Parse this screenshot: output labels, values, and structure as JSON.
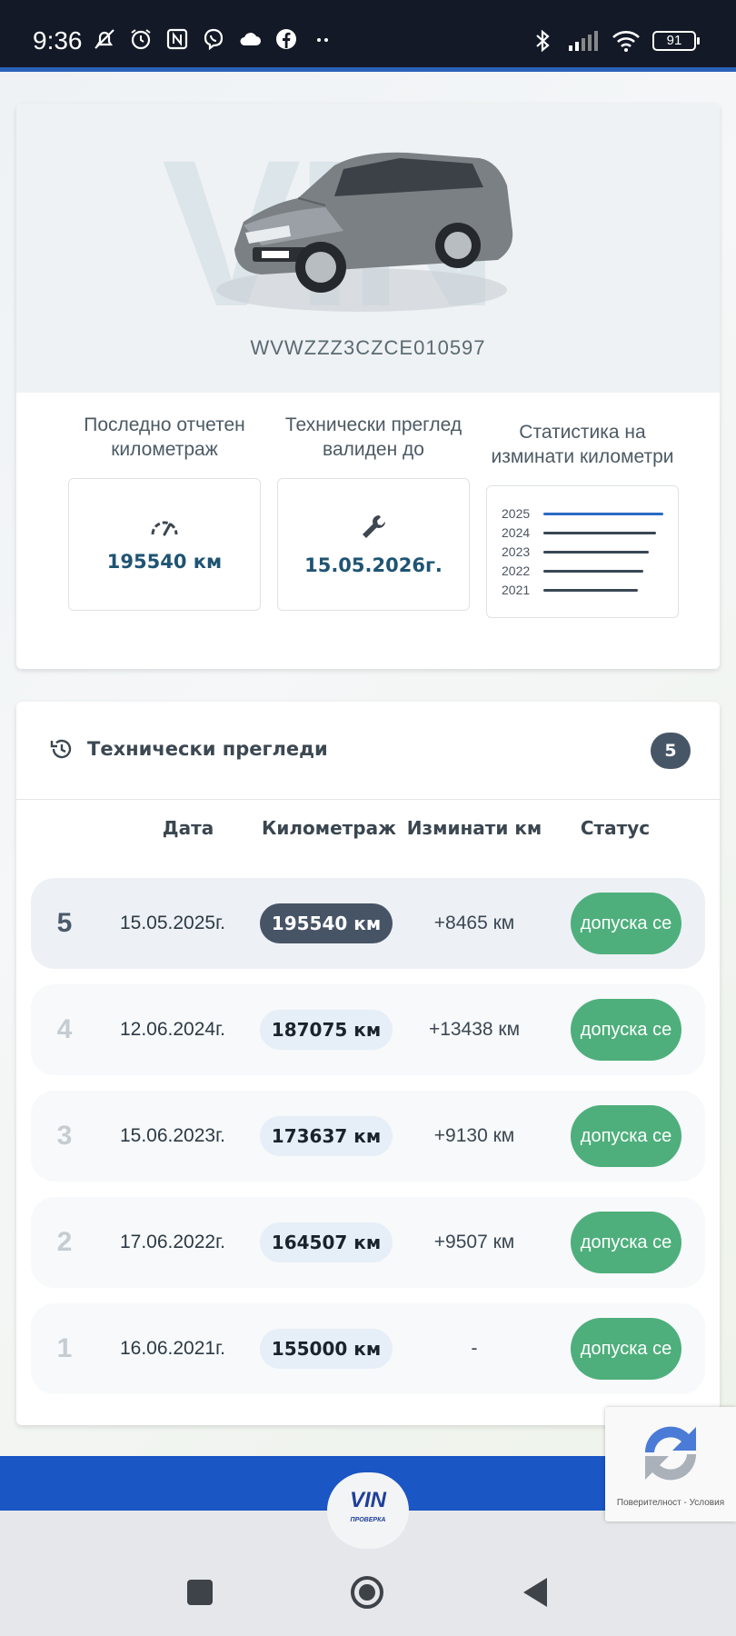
{
  "status_bar": {
    "time": "9:36",
    "battery": "91",
    "left_icons": [
      "mute-icon",
      "alarm-icon",
      "nfc-icon",
      "viber-icon",
      "cloud-icon",
      "facebook-icon",
      "more-dots-icon"
    ],
    "right_icons": [
      "bluetooth-icon",
      "signal-icon",
      "wifi-icon",
      "battery-icon"
    ]
  },
  "vehicle": {
    "watermark": "VIN",
    "vin": "WVWZZZ3CZCE010597"
  },
  "stats": {
    "mileage_title": "Последно отчетен километраж",
    "mileage_value": "195540 км",
    "inspection_title": "Технически преглед валиден до",
    "inspection_value": "15.05.2026г.",
    "chart_title": "Статистика на изминати километри",
    "chart_years": [
      "2025",
      "2024",
      "2023",
      "2022",
      "2021"
    ],
    "accent_color": "#2a6ac4"
  },
  "inspections": {
    "title": "Технически прегледи",
    "count": "5",
    "columns": {
      "date": "Дата",
      "mileage": "Километраж",
      "traveled": "Изминати км",
      "status": "Статус"
    },
    "rows": [
      {
        "num": "5",
        "date": "15.05.2025г.",
        "km": "195540 км",
        "diff": "+8465 км",
        "status": "допуска се"
      },
      {
        "num": "4",
        "date": "12.06.2024г.",
        "km": "187075 км",
        "diff": "+13438 км",
        "status": "допуска се"
      },
      {
        "num": "3",
        "date": "15.06.2023г.",
        "km": "173637 км",
        "diff": "+9130 км",
        "status": "допуска се"
      },
      {
        "num": "2",
        "date": "17.06.2022г.",
        "km": "164507 км",
        "diff": "+9507 км",
        "status": "допуска се"
      },
      {
        "num": "1",
        "date": "16.06.2021г.",
        "km": "155000 км",
        "diff": "-",
        "status": "допуска се"
      }
    ]
  },
  "footer": {
    "logo_main": "VIN",
    "logo_sub": "ПРОВЕРКА"
  },
  "recaptcha": {
    "terms": "Поверителност - Условия"
  },
  "navbar": {
    "buttons": [
      "recents-square-icon",
      "home-circle-icon",
      "back-triangle-icon"
    ]
  }
}
